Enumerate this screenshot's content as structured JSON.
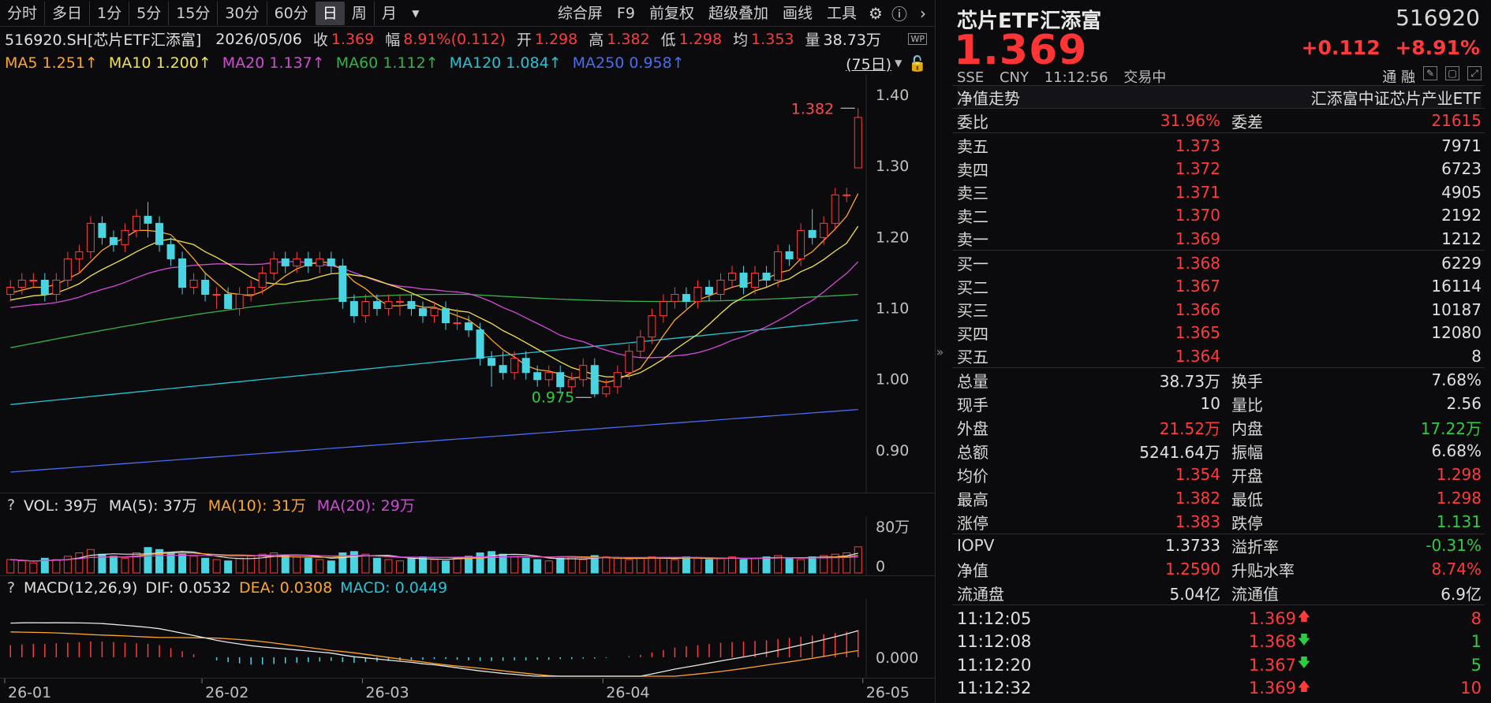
{
  "toolbar": {
    "periods": [
      "分时",
      "多日",
      "1分",
      "5分",
      "15分",
      "30分",
      "60分",
      "日",
      "周",
      "月"
    ],
    "active_period": "日",
    "tools": [
      "综合屏",
      "F9",
      "前复权",
      "超级叠加",
      "画线",
      "工具"
    ]
  },
  "info": {
    "code_name": "516920.SH[芯片ETF汇添富]",
    "date": "2026/05/06",
    "close_label": "收",
    "close": "1.369",
    "range_label": "幅",
    "range": "8.91%(0.112)",
    "open_label": "开",
    "open": "1.298",
    "high_label": "高",
    "high": "1.382",
    "low_label": "低",
    "low": "1.298",
    "avg_label": "均",
    "avg": "1.353",
    "vol_label": "量",
    "vol": "38.73万"
  },
  "ma": {
    "ma5": "MA5 1.251↑",
    "ma10": "MA10 1.200↑",
    "ma20": "MA20 1.137↑",
    "ma60": "MA60 1.112↑",
    "ma120": "MA120 1.084↑",
    "ma250": "MA250 0.958↑",
    "days": "(75日)"
  },
  "colors": {
    "up": "#ff3b3b",
    "down": "#2ecc40",
    "candle_down": "#4ad3e0",
    "ma5": "#ffa62b",
    "ma10": "#f2e34a",
    "ma20": "#d24bd8",
    "ma60": "#35b34a",
    "ma120": "#27c3d6",
    "ma250": "#4a6cf0"
  },
  "vol": {
    "label": "VOL: 39万",
    "ma5": "MA(5): 37万",
    "ma10": "MA(10): 31万",
    "ma20": "MA(20): 29万",
    "axis_top": "80万",
    "axis_zero": "0"
  },
  "macd": {
    "label": "MACD(12,26,9)",
    "dif": "DIF: 0.0532",
    "dea": "DEA: 0.0308",
    "macd": "MACD: 0.0449",
    "axis_zero": "0.000"
  },
  "price_axis": [
    "1.40",
    "1.30",
    "1.20",
    "1.10",
    "1.00",
    "0.90"
  ],
  "annotations": {
    "high": "1.382",
    "low": "0.975"
  },
  "x_labels": [
    "26-01",
    "26-02",
    "26-03",
    "26-04",
    "26-05"
  ],
  "chart_data": {
    "type": "candlestick",
    "ylim": [
      0.85,
      1.42
    ],
    "candles": [
      [
        1.12,
        1.13,
        1.11,
        1.14
      ],
      [
        1.13,
        1.14,
        1.12,
        1.15
      ],
      [
        1.14,
        1.14,
        1.13,
        1.15
      ],
      [
        1.14,
        1.12,
        1.11,
        1.15
      ],
      [
        1.12,
        1.14,
        1.11,
        1.15
      ],
      [
        1.14,
        1.17,
        1.13,
        1.18
      ],
      [
        1.17,
        1.18,
        1.15,
        1.19
      ],
      [
        1.18,
        1.22,
        1.17,
        1.23
      ],
      [
        1.22,
        1.2,
        1.19,
        1.23
      ],
      [
        1.2,
        1.19,
        1.18,
        1.21
      ],
      [
        1.19,
        1.21,
        1.18,
        1.22
      ],
      [
        1.21,
        1.23,
        1.2,
        1.24
      ],
      [
        1.23,
        1.22,
        1.2,
        1.25
      ],
      [
        1.22,
        1.19,
        1.18,
        1.23
      ],
      [
        1.19,
        1.17,
        1.16,
        1.2
      ],
      [
        1.17,
        1.13,
        1.12,
        1.18
      ],
      [
        1.13,
        1.14,
        1.12,
        1.15
      ],
      [
        1.14,
        1.12,
        1.11,
        1.15
      ],
      [
        1.12,
        1.12,
        1.1,
        1.13
      ],
      [
        1.12,
        1.1,
        1.1,
        1.13
      ],
      [
        1.1,
        1.12,
        1.09,
        1.13
      ],
      [
        1.12,
        1.13,
        1.11,
        1.14
      ],
      [
        1.13,
        1.15,
        1.12,
        1.16
      ],
      [
        1.15,
        1.17,
        1.14,
        1.18
      ],
      [
        1.17,
        1.16,
        1.15,
        1.18
      ],
      [
        1.16,
        1.17,
        1.15,
        1.18
      ],
      [
        1.17,
        1.16,
        1.15,
        1.18
      ],
      [
        1.16,
        1.17,
        1.15,
        1.18
      ],
      [
        1.17,
        1.16,
        1.15,
        1.18
      ],
      [
        1.16,
        1.11,
        1.1,
        1.17
      ],
      [
        1.11,
        1.09,
        1.08,
        1.12
      ],
      [
        1.09,
        1.11,
        1.08,
        1.12
      ],
      [
        1.11,
        1.1,
        1.09,
        1.12
      ],
      [
        1.1,
        1.11,
        1.09,
        1.12
      ],
      [
        1.11,
        1.11,
        1.09,
        1.12
      ],
      [
        1.11,
        1.1,
        1.09,
        1.12
      ],
      [
        1.1,
        1.09,
        1.08,
        1.11
      ],
      [
        1.09,
        1.1,
        1.08,
        1.11
      ],
      [
        1.1,
        1.08,
        1.07,
        1.11
      ],
      [
        1.08,
        1.08,
        1.07,
        1.1
      ],
      [
        1.08,
        1.07,
        1.06,
        1.09
      ],
      [
        1.07,
        1.03,
        1.02,
        1.08
      ],
      [
        1.03,
        1.02,
        0.99,
        1.04
      ],
      [
        1.02,
        1.01,
        1.0,
        1.04
      ],
      [
        1.01,
        1.03,
        1.0,
        1.04
      ],
      [
        1.03,
        1.01,
        1.0,
        1.04
      ],
      [
        1.01,
        1.0,
        0.99,
        1.02
      ],
      [
        1.0,
        1.01,
        0.99,
        1.02
      ],
      [
        1.01,
        0.99,
        0.98,
        1.02
      ],
      [
        0.99,
        1.0,
        0.98,
        1.01
      ],
      [
        1.0,
        1.02,
        0.99,
        1.03
      ],
      [
        1.02,
        0.98,
        0.975,
        1.03
      ],
      [
        0.98,
        0.99,
        0.975,
        1.0
      ],
      [
        0.99,
        1.01,
        0.98,
        1.02
      ],
      [
        1.01,
        1.04,
        1.0,
        1.05
      ],
      [
        1.04,
        1.06,
        1.03,
        1.07
      ],
      [
        1.06,
        1.09,
        1.05,
        1.1
      ],
      [
        1.09,
        1.11,
        1.08,
        1.12
      ],
      [
        1.11,
        1.12,
        1.1,
        1.13
      ],
      [
        1.12,
        1.11,
        1.1,
        1.13
      ],
      [
        1.11,
        1.13,
        1.1,
        1.14
      ],
      [
        1.13,
        1.12,
        1.11,
        1.14
      ],
      [
        1.12,
        1.14,
        1.11,
        1.15
      ],
      [
        1.14,
        1.15,
        1.13,
        1.16
      ],
      [
        1.15,
        1.13,
        1.12,
        1.16
      ],
      [
        1.13,
        1.15,
        1.12,
        1.16
      ],
      [
        1.15,
        1.14,
        1.13,
        1.16
      ],
      [
        1.14,
        1.18,
        1.13,
        1.19
      ],
      [
        1.18,
        1.17,
        1.16,
        1.19
      ],
      [
        1.17,
        1.21,
        1.16,
        1.22
      ],
      [
        1.21,
        1.2,
        1.19,
        1.24
      ],
      [
        1.2,
        1.22,
        1.19,
        1.23
      ],
      [
        1.22,
        1.26,
        1.21,
        1.27
      ],
      [
        1.26,
        1.26,
        1.25,
        1.27
      ],
      [
        1.298,
        1.369,
        1.298,
        1.382
      ]
    ],
    "volumes": [
      20,
      18,
      15,
      22,
      20,
      25,
      30,
      35,
      28,
      25,
      22,
      30,
      38,
      35,
      30,
      28,
      25,
      22,
      20,
      18,
      22,
      25,
      28,
      30,
      26,
      24,
      22,
      20,
      18,
      30,
      32,
      28,
      22,
      20,
      18,
      22,
      24,
      20,
      18,
      22,
      25,
      30,
      32,
      28,
      24,
      22,
      20,
      18,
      22,
      24,
      20,
      26,
      24,
      22,
      20,
      22,
      24,
      22,
      20,
      24,
      22,
      20,
      22,
      24,
      20,
      22,
      24,
      26,
      22,
      20,
      24,
      26,
      28,
      30,
      39
    ],
    "macd_hist": [
      0.02,
      0.021,
      0.022,
      0.022,
      0.023,
      0.024,
      0.025,
      0.026,
      0.026,
      0.025,
      0.024,
      0.023,
      0.022,
      0.02,
      0.015,
      0.01,
      0.005,
      0.0,
      -0.005,
      -0.008,
      -0.01,
      -0.012,
      -0.012,
      -0.011,
      -0.01,
      -0.009,
      -0.008,
      -0.007,
      -0.006,
      -0.008,
      -0.009,
      -0.008,
      -0.007,
      -0.006,
      -0.005,
      -0.004,
      -0.004,
      -0.003,
      -0.003,
      -0.004,
      -0.005,
      -0.006,
      -0.006,
      -0.006,
      -0.005,
      -0.005,
      -0.004,
      -0.004,
      -0.003,
      -0.003,
      -0.002,
      -0.002,
      -0.001,
      0.0,
      0.002,
      0.004,
      0.008,
      0.012,
      0.016,
      0.018,
      0.02,
      0.022,
      0.024,
      0.025,
      0.026,
      0.027,
      0.028,
      0.03,
      0.032,
      0.034,
      0.036,
      0.038,
      0.04,
      0.042,
      0.0449
    ]
  },
  "quote": {
    "title": "芯片ETF汇添富",
    "code": "516920",
    "price": "1.369",
    "change": "+0.112",
    "change_pct": "+8.91%",
    "exchange": "SSE",
    "currency": "CNY",
    "time": "11:12:56",
    "status": "交易中",
    "tong_rong": "通 融",
    "nav_trend": "净值走势",
    "index_name": "汇添富中证芯片产业ETF",
    "wei_bi_label": "委比",
    "wei_bi": "31.96%",
    "wei_cha_label": "委差",
    "wei_cha": "21615",
    "sells": [
      {
        "label": "卖五",
        "price": "1.373",
        "qty": "7971"
      },
      {
        "label": "卖四",
        "price": "1.372",
        "qty": "6723"
      },
      {
        "label": "卖三",
        "price": "1.371",
        "qty": "4905"
      },
      {
        "label": "卖二",
        "price": "1.370",
        "qty": "2192"
      },
      {
        "label": "卖一",
        "price": "1.369",
        "qty": "1212"
      }
    ],
    "buys": [
      {
        "label": "买一",
        "price": "1.368",
        "qty": "6229"
      },
      {
        "label": "买二",
        "price": "1.367",
        "qty": "16114"
      },
      {
        "label": "买三",
        "price": "1.366",
        "qty": "10187"
      },
      {
        "label": "买四",
        "price": "1.365",
        "qty": "12080"
      },
      {
        "label": "买五",
        "price": "1.364",
        "qty": "8"
      }
    ],
    "stats": [
      {
        "k": "总量",
        "v": "38.73万",
        "c1": "wh",
        "k2": "换手",
        "v2": "7.68%",
        "c2": "wh"
      },
      {
        "k": "现手",
        "v": "10",
        "c1": "wh",
        "k2": "量比",
        "v2": "2.56",
        "c2": "wh"
      },
      {
        "k": "外盘",
        "v": "21.52万",
        "c1": "up",
        "k2": "内盘",
        "v2": "17.22万",
        "c2": "dn"
      },
      {
        "k": "总额",
        "v": "5241.64万",
        "c1": "wh",
        "k2": "振幅",
        "v2": "6.68%",
        "c2": "wh"
      },
      {
        "k": "均价",
        "v": "1.354",
        "c1": "up",
        "k2": "开盘",
        "v2": "1.298",
        "c2": "up"
      },
      {
        "k": "最高",
        "v": "1.382",
        "c1": "up",
        "k2": "最低",
        "v2": "1.298",
        "c2": "up"
      },
      {
        "k": "涨停",
        "v": "1.383",
        "c1": "up",
        "k2": "跌停",
        "v2": "1.131",
        "c2": "dn"
      }
    ],
    "stats2": [
      {
        "k": "IOPV",
        "v": "1.3733",
        "c1": "wh",
        "k2": "溢折率",
        "v2": "-0.31%",
        "c2": "dn"
      },
      {
        "k": "净值",
        "v": "1.2590",
        "c1": "up",
        "k2": "升贴水率",
        "v2": "8.74%",
        "c2": "up"
      },
      {
        "k": "流通盘",
        "v": "5.04亿",
        "c1": "wh",
        "k2": "流通值",
        "v2": "6.9亿",
        "c2": "wh"
      }
    ],
    "ticks": [
      {
        "time": "11:12:05",
        "price": "1.369",
        "dir": "up",
        "qty": "8"
      },
      {
        "time": "11:12:08",
        "price": "1.368",
        "dir": "dn",
        "qty": "1"
      },
      {
        "time": "11:12:20",
        "price": "1.367",
        "dir": "dn",
        "qty": "5"
      },
      {
        "time": "11:12:32",
        "price": "1.369",
        "dir": "up",
        "qty": "10"
      }
    ]
  }
}
